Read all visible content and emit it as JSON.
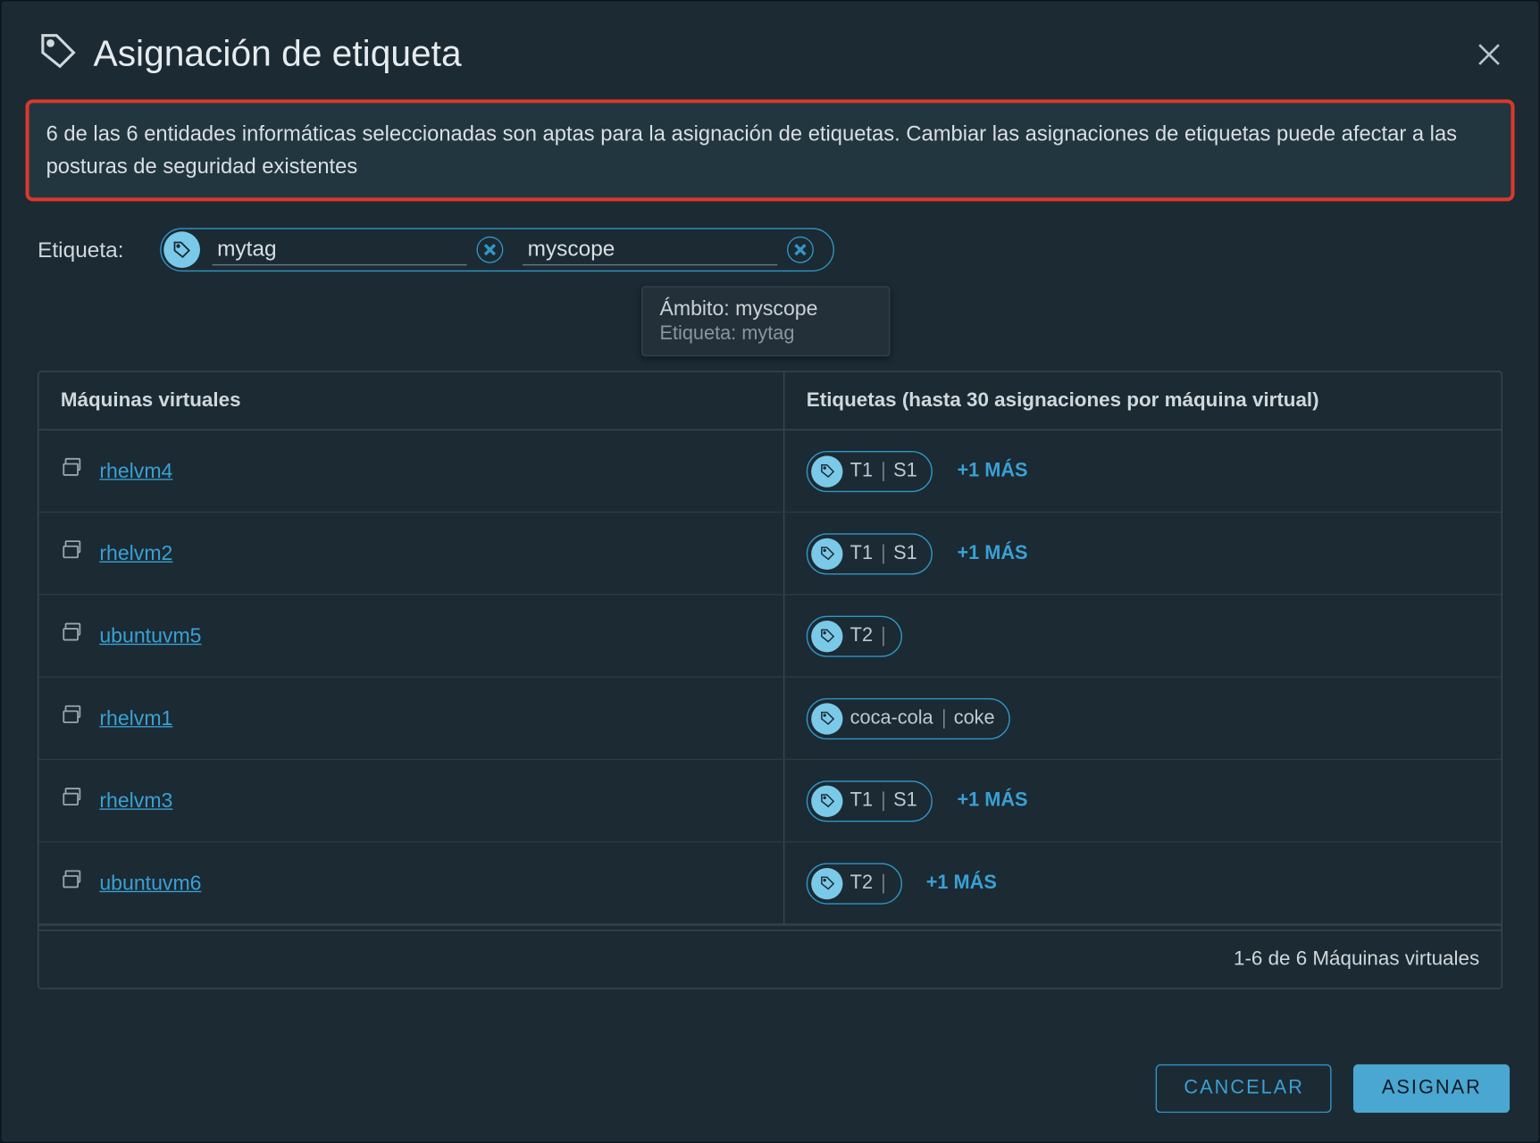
{
  "dialog": {
    "title": "Asignación de etiqueta",
    "alert": "6 de las 6 entidades informáticas seleccionadas son aptas para la asignación de etiquetas. Cambiar las asignaciones de etiquetas puede afectar a las posturas de seguridad existentes"
  },
  "tag_input": {
    "label": "Etiqueta:",
    "tag_value": "mytag",
    "scope_value": "myscope"
  },
  "tooltip": {
    "line1": "Ámbito: myscope",
    "line2": "Etiqueta: mytag"
  },
  "table": {
    "header_vm": "Máquinas virtuales",
    "header_tags": "Etiquetas (hasta 30 asignaciones por máquina virtual)",
    "rows": [
      {
        "name": "rhelvm4",
        "tag": "T1",
        "scope": "S1",
        "more": "+1 MÁS"
      },
      {
        "name": "rhelvm2",
        "tag": "T1",
        "scope": "S1",
        "more": "+1 MÁS"
      },
      {
        "name": "ubuntuvm5",
        "tag": "T2",
        "scope": "",
        "more": ""
      },
      {
        "name": "rhelvm1",
        "tag": "coca-cola",
        "scope": "coke",
        "more": ""
      },
      {
        "name": "rhelvm3",
        "tag": "T1",
        "scope": "S1",
        "more": "+1 MÁS"
      },
      {
        "name": "ubuntuvm6",
        "tag": "T2",
        "scope": "",
        "more": "+1 MÁS"
      }
    ],
    "footer": "1-6 de 6 Máquinas virtuales"
  },
  "buttons": {
    "cancel": "CANCELAR",
    "assign": "ASIGNAR"
  }
}
